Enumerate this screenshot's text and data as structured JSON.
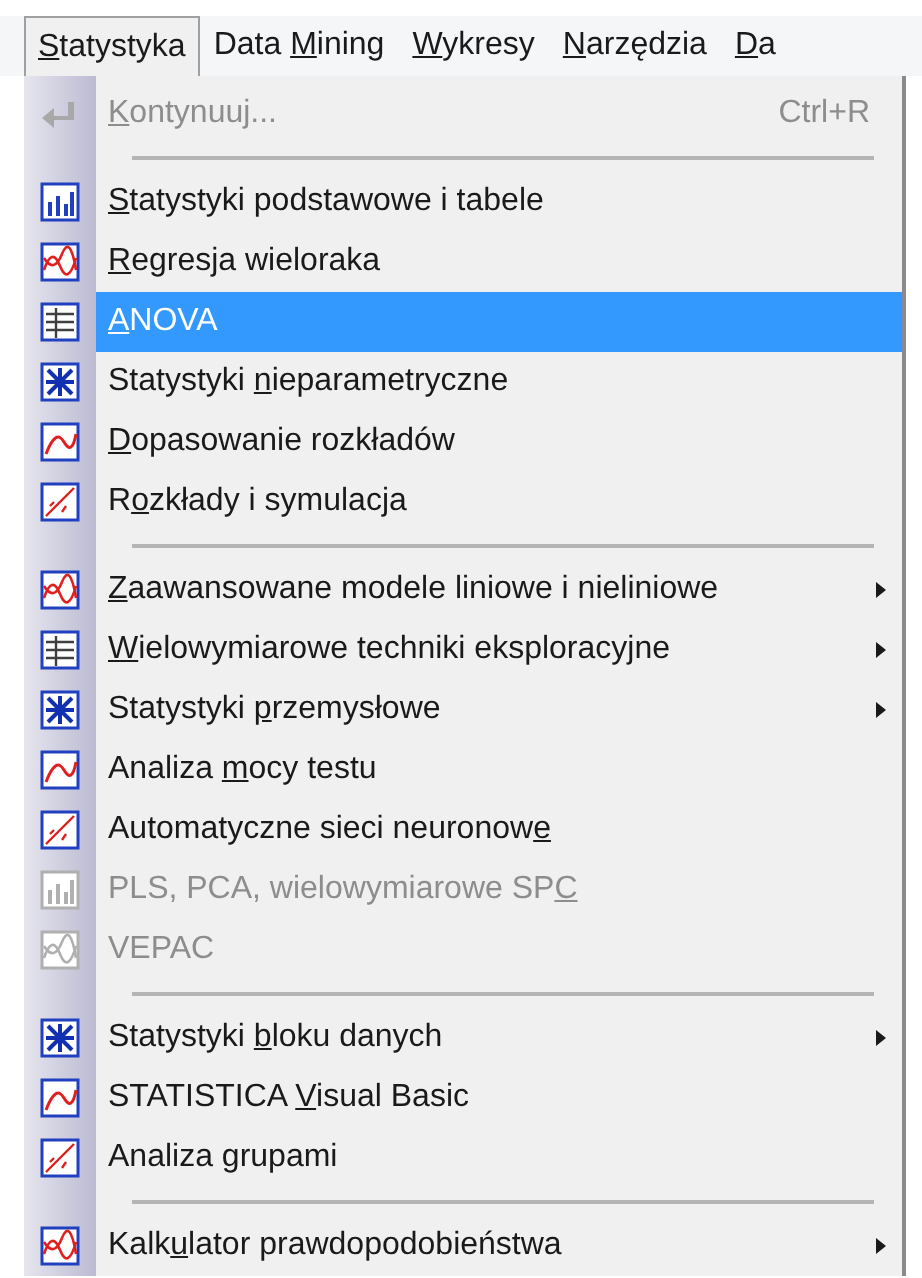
{
  "menu_bar": [
    {
      "key": "S",
      "post": "tatystyka",
      "selected": true
    },
    {
      "pre": "Data ",
      "key": "M",
      "post": "ining",
      "selected": false
    },
    {
      "key": "W",
      "post": "ykresy",
      "selected": false
    },
    {
      "key": "N",
      "post": "arzędzia",
      "selected": false
    },
    {
      "key": "D",
      "post": "a",
      "selected": false
    }
  ],
  "menu": [
    {
      "kind": "item",
      "key": "K",
      "post": "ontynuuj...",
      "shortcut": "Ctrl+R",
      "disabled": true,
      "selected": false,
      "submenu": false
    },
    {
      "kind": "separator"
    },
    {
      "kind": "item",
      "key": "S",
      "post": "tatystyki podstawowe i tabele",
      "disabled": false,
      "selected": false,
      "submenu": false
    },
    {
      "kind": "item",
      "key": "R",
      "post": "egresja wieloraka",
      "disabled": false,
      "selected": false,
      "submenu": false
    },
    {
      "kind": "item",
      "key": "A",
      "post": "NOVA",
      "disabled": false,
      "selected": true,
      "submenu": false
    },
    {
      "kind": "item",
      "pre": "Statystyki ",
      "key": "n",
      "post": "ieparametryczne",
      "disabled": false,
      "selected": false,
      "submenu": false
    },
    {
      "kind": "item",
      "key": "D",
      "post": "opasowanie rozkładów",
      "disabled": false,
      "selected": false,
      "submenu": false
    },
    {
      "kind": "item",
      "pre": "R",
      "key": "o",
      "post": "zkłady i symulacja",
      "disabled": false,
      "selected": false,
      "submenu": false
    },
    {
      "kind": "separator"
    },
    {
      "kind": "item",
      "key": "Z",
      "post": "aawansowane modele liniowe i nieliniowe",
      "disabled": false,
      "selected": false,
      "submenu": true
    },
    {
      "kind": "item",
      "key": "W",
      "post": "ielowymiarowe techniki eksploracyjne",
      "disabled": false,
      "selected": false,
      "submenu": true
    },
    {
      "kind": "item",
      "pre": "Statystyki ",
      "key": "p",
      "post": "rzemysłowe",
      "disabled": false,
      "selected": false,
      "submenu": true
    },
    {
      "kind": "item",
      "pre": "Analiza ",
      "key": "m",
      "post": "ocy testu",
      "disabled": false,
      "selected": false,
      "submenu": false
    },
    {
      "kind": "item",
      "pre": "Automatyczne sieci neuronow",
      "key": "e",
      "disabled": false,
      "selected": false,
      "submenu": false
    },
    {
      "kind": "item",
      "pre": "PLS, PCA, wielowymiarowe SP",
      "key": "C",
      "disabled": true,
      "selected": false,
      "submenu": false
    },
    {
      "kind": "item",
      "pre": "VEPAC",
      "disabled": true,
      "selected": false,
      "submenu": false
    },
    {
      "kind": "separator"
    },
    {
      "kind": "item",
      "pre": "Statystyki ",
      "key": "b",
      "post": "loku danych",
      "disabled": false,
      "selected": false,
      "submenu": true
    },
    {
      "kind": "item",
      "pre": "STATISTICA ",
      "key": "V",
      "post": "isual Basic",
      "disabled": false,
      "selected": false,
      "submenu": false
    },
    {
      "kind": "item",
      "pre": "Analiza grupami",
      "disabled": false,
      "selected": false,
      "submenu": false
    },
    {
      "kind": "separator"
    },
    {
      "kind": "item",
      "pre": "Kalk",
      "key": "u",
      "post": "lator prawdopodobieństwa",
      "disabled": false,
      "selected": false,
      "submenu": true
    }
  ]
}
